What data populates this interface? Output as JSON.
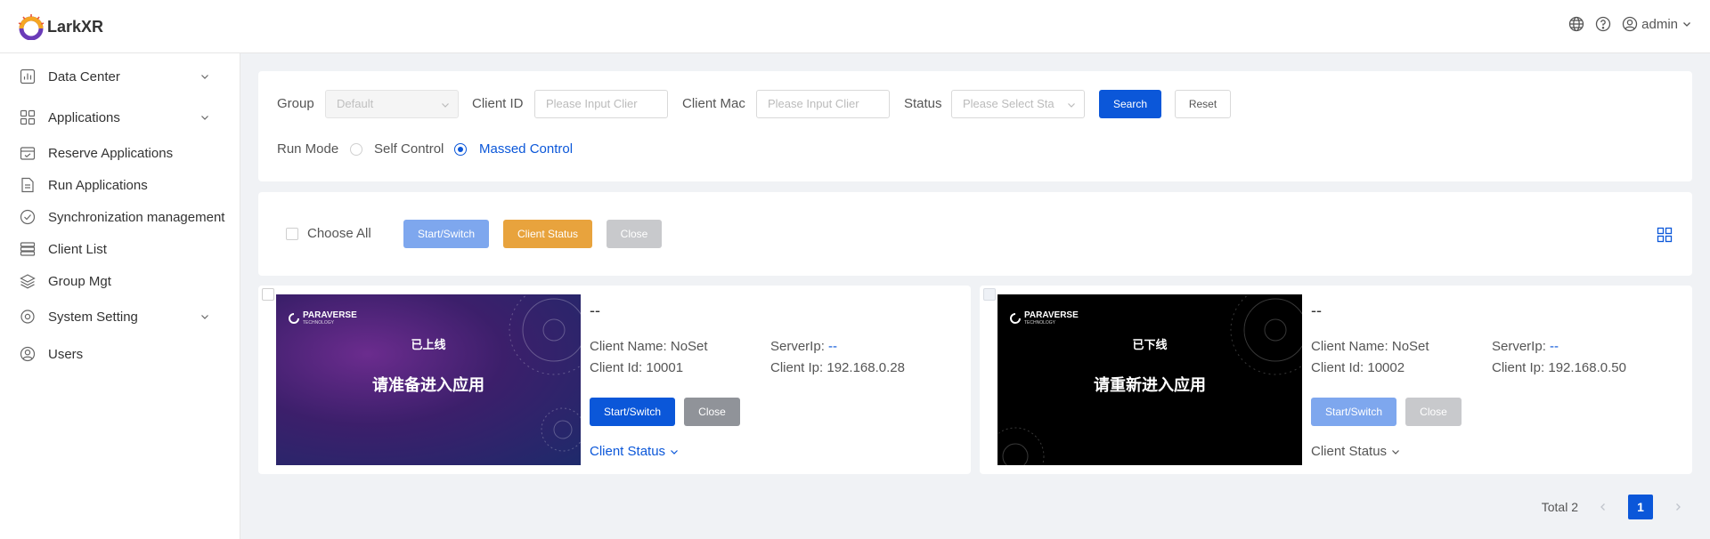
{
  "app": {
    "logo_text": "LarkXR"
  },
  "header": {
    "user": "admin"
  },
  "sidebar": {
    "items": [
      {
        "label": "Data Center",
        "icon": "chart-icon",
        "has_children": true
      },
      {
        "label": "Applications",
        "icon": "apps-icon",
        "has_children": true
      },
      {
        "label": "Reserve Applications",
        "icon": "calendar-check-icon",
        "has_children": false
      },
      {
        "label": "Run Applications",
        "icon": "document-icon",
        "has_children": false
      },
      {
        "label": "Synchronization management",
        "icon": "check-circle-icon",
        "has_children": false
      },
      {
        "label": "Client List",
        "icon": "list-icon",
        "has_children": false
      },
      {
        "label": "Group Mgt",
        "icon": "layers-icon",
        "has_children": false
      },
      {
        "label": "System Setting",
        "icon": "gear-icon",
        "has_children": true
      },
      {
        "label": "Users",
        "icon": "user-icon",
        "has_children": false
      }
    ]
  },
  "filter": {
    "group_label": "Group",
    "group_value": "Default",
    "client_id_label": "Client ID",
    "client_id_placeholder": "Please Input Clier",
    "client_mac_label": "Client Mac",
    "client_mac_placeholder": "Please Input Clier",
    "status_label": "Status",
    "status_placeholder": "Please Select Sta",
    "search_label": "Search",
    "reset_label": "Reset",
    "run_mode_label": "Run Mode",
    "run_mode_options": [
      "Self Control",
      "Massed Control"
    ],
    "run_mode_selected": "Massed Control"
  },
  "actions": {
    "choose_all_label": "Choose All",
    "start_label": "Start/Switch",
    "client_status_label": "Client Status",
    "close_label": "Close"
  },
  "clients": [
    {
      "title": "--",
      "client_name_label": "Client Name:",
      "client_name": "NoSet",
      "server_ip_label": "ServerIp:",
      "server_ip": "--",
      "client_id_label": "Client Id:",
      "client_id": "10001",
      "client_ip_label": "Client Ip:",
      "client_ip": "192.168.0.28",
      "start_label": "Start/Switch",
      "close_label": "Close",
      "status_link": "Client Status",
      "thumb_brand": "PARAVERSE",
      "thumb_brand_sub": "TECHNOLOGY",
      "thumb_line1": "已上线",
      "thumb_line2": "请准备进入应用",
      "online": true
    },
    {
      "title": "--",
      "client_name_label": "Client Name:",
      "client_name": "NoSet",
      "server_ip_label": "ServerIp:",
      "server_ip": "--",
      "client_id_label": "Client Id:",
      "client_id": "10002",
      "client_ip_label": "Client Ip:",
      "client_ip": "192.168.0.50",
      "start_label": "Start/Switch",
      "close_label": "Close",
      "status_link": "Client Status",
      "thumb_brand": "PARAVERSE",
      "thumb_brand_sub": "TECHNOLOGY",
      "thumb_line1": "已下线",
      "thumb_line2": "请重新进入应用",
      "online": false
    }
  ],
  "pagination": {
    "total_label": "Total 2",
    "current_page": "1"
  },
  "colors": {
    "primary": "#0b57d9",
    "orange": "#e8a33d",
    "gray": "#c8c9cc"
  }
}
